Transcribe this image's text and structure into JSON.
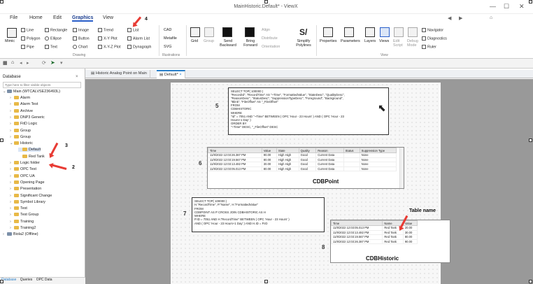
{
  "window": {
    "title": "MainHistoric.Default* - ViewX"
  },
  "menu": [
    "File",
    "Home",
    "Edit",
    "Graphics",
    "View"
  ],
  "ribbon": {
    "mimic": "Mimic",
    "drawing_items": [
      "Line",
      "Polygon",
      "Pipe",
      "Rectangle",
      "Ellipse",
      "Text",
      "Image",
      "Button",
      "Chart",
      "Trend",
      "X-Y Plot",
      "X-Y-Z Plot",
      "List",
      "Alarm List",
      "Dynagraph"
    ],
    "drawing_label": "Drawing",
    "illus_items": [
      "CAD",
      "Metafile",
      "SVG"
    ],
    "illus_label": "Illustrations",
    "arrange_items": [
      "Grid",
      "Group",
      "Send Backward",
      "Bring Forward",
      "Align",
      "Distribute",
      "Orientation",
      "Simplify Polylines"
    ],
    "view_items": [
      "Properties",
      "Parameters",
      "Layers",
      "Views",
      "Edit Script",
      "Debug Mode"
    ],
    "view_small": [
      "Navigator",
      "Diagnostics",
      "Ruler"
    ],
    "view_label": "View"
  },
  "sidebar": {
    "header": "Database",
    "filter_placeholder": "Type here to filter visible objects",
    "root": "Main (WTCALVSE236493L)",
    "items": [
      "Alarm",
      "Alarm Test",
      "Archive",
      "DNP3 Generic",
      "FitD Logic",
      "Group",
      "Group",
      "Historic",
      "Default",
      "Red Tank",
      "Logic folder",
      "OPC Test",
      "OPC UA",
      "Opening Page",
      "Presentation",
      "Significant Change",
      "Symbol Library",
      "Test",
      "Test Group",
      "Training",
      "Training2"
    ],
    "root2": "Biola2 (Offline)",
    "bottom_tabs": [
      "Database",
      "Queries",
      "OPC Data"
    ]
  },
  "tabs": [
    "Historic Analog Point on Main",
    "Default*"
  ],
  "sql1": "SELECT TOP( 100000 )\n\"RecordId\", \"RecordTime\" AS \"~Time\", \"FormattedValue\", \"StateDesc\", \"QualityDesc\",\n\"ReasonDesc\", \"StatusDesc\", \"SuppressionTypeDesc\", \"Foreground\", \"Background\",\n\"Blink\", \"FileOffset\" AS \"_FileOffset\"\nFROM\nCDBHISTORIC\nWHERE\n\"Id\" = 7051 AND \"~Time\" BETWEEN ( OPC 'Hour - 23 Hours' ) AND ( OPC 'Hour - 23\nHours+1 Day' )\nORDER BY\n\"~Time\" DESC, \"_FileOffset\" DESC",
  "sql2": "SELECT TOP( 100000 )\nH.\"RecordTime\", P.\"Name\", H.\"FormattedValue\"\nFROM\nCDBPOINT AS P CROSS JOIN CDBHISTORIC AS H\nWHERE\nP.ID = 7051 AND H.\"RecordTime\" BETWEEN ( OPC 'Hour - 23 Hours' )\nAND ( OPC 'Hour - 23 Hours+1 Day' ) AND H.ID = P.ID",
  "grid1": {
    "headers": [
      "Time",
      "Value",
      "State",
      "Quality",
      "Reason",
      "Status",
      "Suppression Type"
    ],
    "rows": [
      [
        "11/9/2022 12:03:26.387 PM",
        "90.00",
        "High High",
        "Good",
        "Current Data",
        "",
        "None"
      ],
      [
        "11/9/2022 12:03:19.567 PM",
        "80.00",
        "High High",
        "Good",
        "Current Data",
        "",
        "None"
      ],
      [
        "11/9/2022 12:03:13.482 PM",
        "30.00",
        "High High",
        "Good",
        "Current Data",
        "",
        "None"
      ],
      [
        "11/9/2022 12:03:05.013 PM",
        "80.00",
        "High High",
        "Good",
        "Current Data",
        "",
        "None"
      ]
    ],
    "caption": "CDBPoint"
  },
  "grid2": {
    "headers": [
      "Time",
      "Name",
      "Value"
    ],
    "rows": [
      [
        "11/9/2022 12:03:05.013 PM",
        "Red Tank",
        "20.00"
      ],
      [
        "11/9/2022 12:03:13.482 PM",
        "Red Tank",
        "30.00"
      ],
      [
        "11/9/2022 12:03:19.567 PM",
        "Red Tank",
        "80.00"
      ],
      [
        "11/9/2022 12:03:26.387 PM",
        "Red Tank",
        "90.00"
      ]
    ],
    "caption": "CDBHistoric",
    "annotation": "Table name"
  },
  "markers": [
    "5",
    "6",
    "7",
    "8"
  ],
  "arrow_nums": [
    "4",
    "3",
    "2"
  ]
}
